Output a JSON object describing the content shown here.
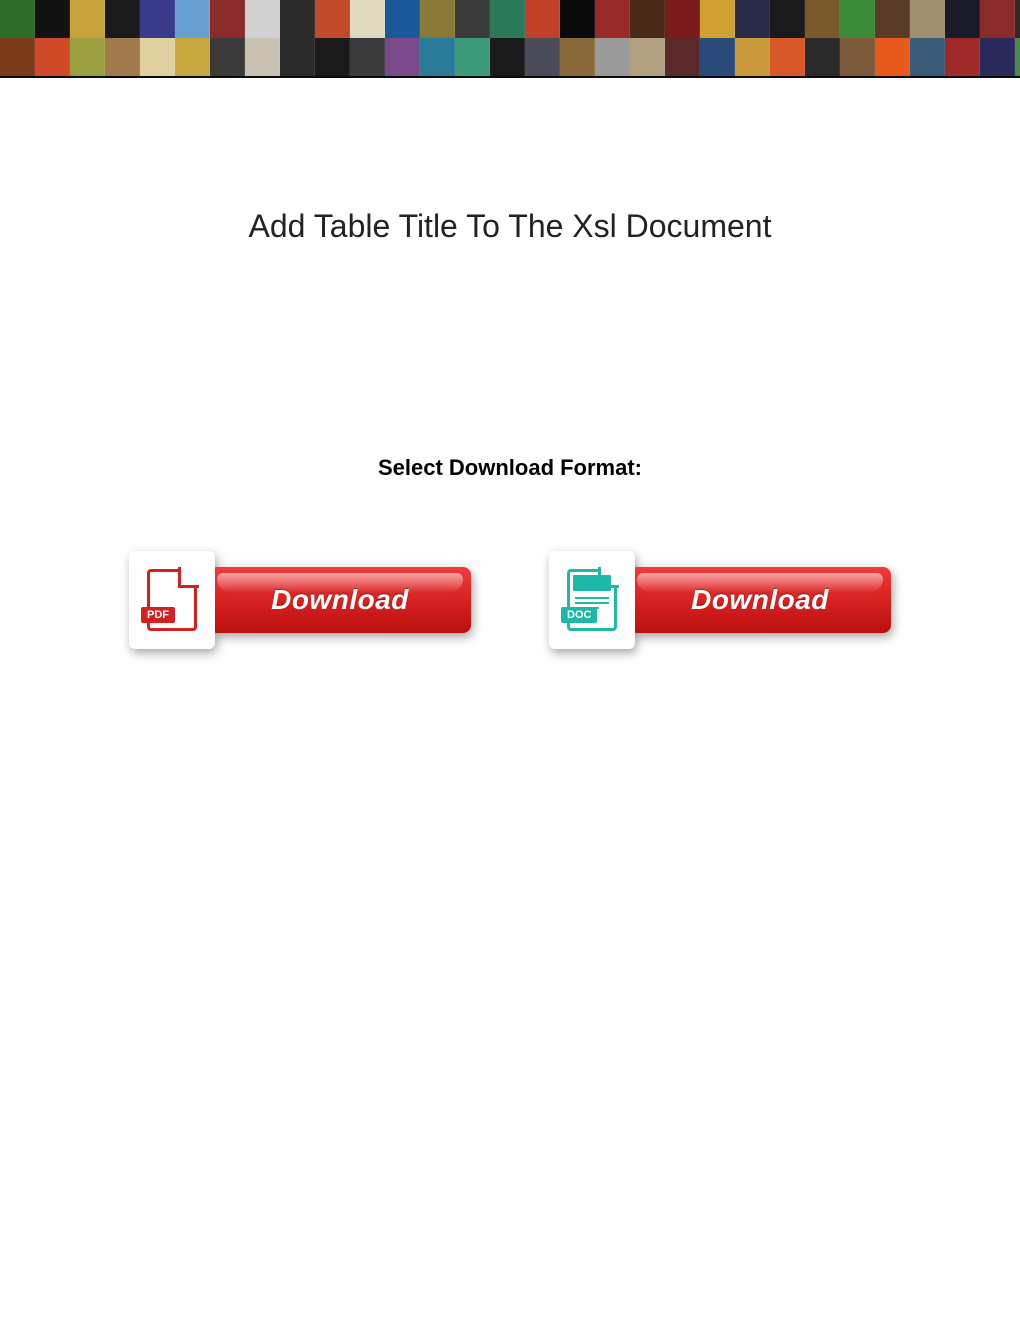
{
  "page": {
    "title": "Add Table Title To The Xsl Document",
    "subtitle": "Select Download Format:"
  },
  "downloads": {
    "pdf": {
      "icon_label": "PDF",
      "button_label": "Download"
    },
    "doc": {
      "icon_label": "DOC",
      "button_label": "Download"
    }
  },
  "banner": {
    "thumb_colors": [
      "#2e6b2a",
      "#121212",
      "#c7a13a",
      "#1a1a1a",
      "#3a3a8a",
      "#6aa0d0",
      "#8a2a2a",
      "#d0d0d0",
      "#2a2a2a",
      "#c04a2a",
      "#e0d8c0",
      "#1a5a9a",
      "#8a7a3a",
      "#3a3a3a",
      "#2a7a5a",
      "#c0402a",
      "#0a0a0a",
      "#9a2a2a",
      "#4a2a1a",
      "#7a1a1a",
      "#d0a030",
      "#2a2a4a",
      "#1a1a1a",
      "#7a5a2a",
      "#3a8a3a",
      "#5a3a2a",
      "#a09070",
      "#1a1a2a",
      "#8a2a2a",
      "#2a2a2a",
      "#7a3a1a",
      "#d04a2a",
      "#9aa040",
      "#a07a4a",
      "#e0d0a0",
      "#c8a840",
      "#3a3a3a",
      "#c8c0b0",
      "#2a2a2a",
      "#1a1a1a",
      "#3a3a3a",
      "#7a4a8a",
      "#2a7a9a",
      "#3a9a7a",
      "#1a1a1a",
      "#4a4a5a",
      "#8a6a3a",
      "#9a9a9a",
      "#b0a080",
      "#5a2a2a",
      "#2a4a7a",
      "#c89a3a",
      "#d8582a",
      "#2a2a2a",
      "#7a5a3a",
      "#e85a1a",
      "#3a5a7a",
      "#a02a2a",
      "#2a2a5a",
      "#4a8a4a"
    ]
  }
}
